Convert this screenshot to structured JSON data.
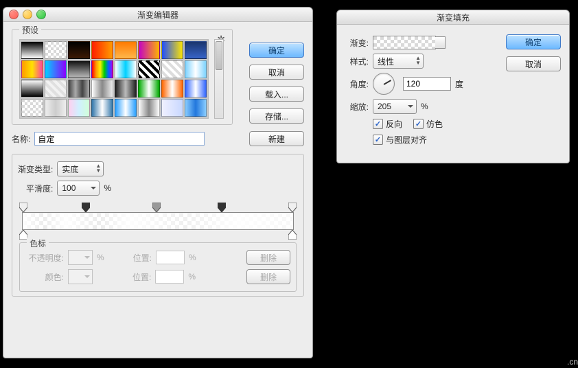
{
  "editor": {
    "title": "渐变编辑器",
    "presets_label": "预设",
    "gear_icon": "✿",
    "ok": "确定",
    "cancel": "取消",
    "load": "载入...",
    "save": "存储...",
    "name_label": "名称:",
    "name_value": "自定",
    "new_btn": "新建",
    "type_label": "渐变类型:",
    "type_value": "实底",
    "smooth_label": "平滑度:",
    "smooth_value": "100",
    "smooth_unit": "%",
    "stops": {
      "group_label": "色标",
      "opacity_label": "不透明度:",
      "opacity_value": "",
      "opacity_unit": "%",
      "position1_label": "位置:",
      "position1_value": "",
      "position1_unit": "%",
      "delete1": "删除",
      "color_label": "颜色:",
      "position2_label": "位置:",
      "position2_value": "",
      "position2_unit": "%",
      "delete2": "删除"
    }
  },
  "fill": {
    "title": "渐变填充",
    "gradient_label": "渐变:",
    "ok": "确定",
    "cancel": "取消",
    "style_label": "样式:",
    "style_value": "线性",
    "angle_label": "角度:",
    "angle_value": "120",
    "angle_unit": "度",
    "scale_label": "缩放:",
    "scale_value": "205",
    "scale_unit": "%",
    "reverse": "反向",
    "dither": "仿色",
    "align": "与图层对齐"
  },
  "watermark": ".cn"
}
